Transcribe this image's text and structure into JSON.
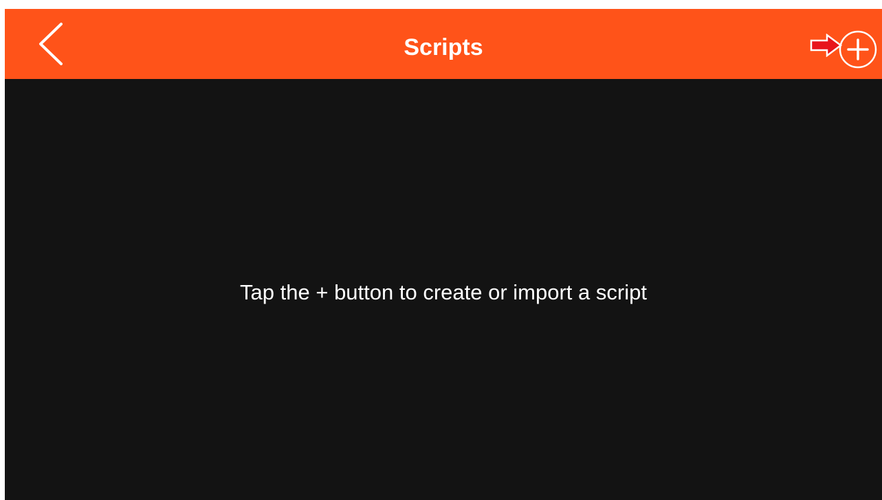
{
  "header": {
    "title": "Scripts",
    "back_icon": "chevron-left-icon",
    "add_icon": "plus-circle-icon",
    "annotation_icon": "red-arrow-right-icon"
  },
  "main": {
    "empty_message": "Tap the + button to create or import a script"
  },
  "colors": {
    "navbar": "#FF5319",
    "background": "#131313",
    "text": "#FFFFFF",
    "annotation_arrow": "#E8141B"
  }
}
